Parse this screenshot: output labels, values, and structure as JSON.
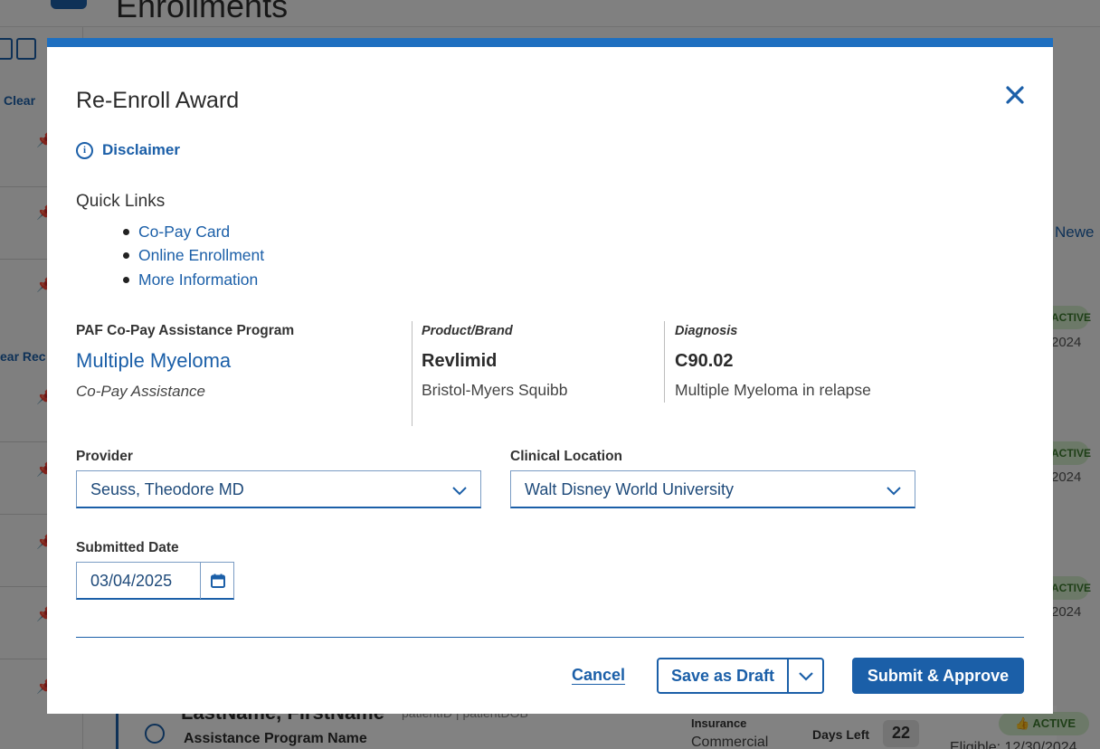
{
  "background": {
    "page_title": "Enrollments",
    "clear_label": "Clear",
    "clear_label_2": "ear Rec",
    "newest_label": "Newe",
    "status_active": "ACTIVE",
    "year": "2024",
    "card": {
      "name": "LastName, FirstName",
      "ids": "patientID  |  patientDOB",
      "program": "Assistance Program Name",
      "insurance_label": "Insurance",
      "insurance_value": "Commercial",
      "days_left_label": "Days Left",
      "days_left_value": "22",
      "status": "ACTIVE",
      "eligible": "Eligible: 12/30/2024"
    }
  },
  "modal": {
    "title": "Re-Enroll Award",
    "disclaimer_label": "Disclaimer",
    "quick_links": {
      "title": "Quick Links",
      "items": [
        "Co-Pay Card",
        "Online Enrollment",
        "More Information"
      ]
    },
    "program": {
      "label": "PAF Co-Pay Assistance Program",
      "name": "Multiple Myeloma",
      "type": "Co-Pay Assistance"
    },
    "product": {
      "label": "Product/Brand",
      "name": "Revlimid",
      "manufacturer": "Bristol-Myers Squibb"
    },
    "diagnosis": {
      "label": "Diagnosis",
      "code": "C90.02",
      "description": "Multiple Myeloma in relapse"
    },
    "provider": {
      "label": "Provider",
      "value": "Seuss, Theodore MD"
    },
    "clinical_location": {
      "label": "Clinical Location",
      "value": "Walt Disney World University"
    },
    "submitted_date": {
      "label": "Submitted Date",
      "value": "03/04/2025"
    },
    "buttons": {
      "cancel": "Cancel",
      "save_draft": "Save as Draft",
      "submit": "Submit & Approve"
    }
  },
  "colors": {
    "primary": "#1b5fa8",
    "modal_top_bar": "#1e6fc0",
    "active_badge": "#cfe8c7"
  }
}
